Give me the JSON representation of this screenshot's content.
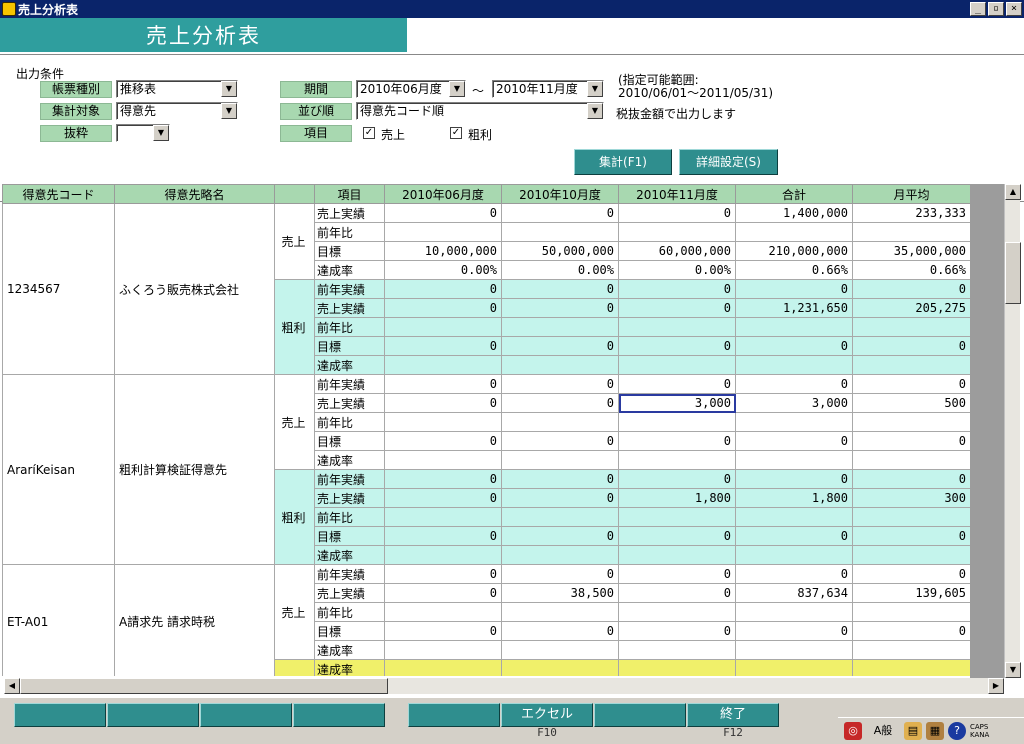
{
  "window": {
    "title": "売上分析表",
    "buttons": [
      "_",
      "▫",
      "×"
    ]
  },
  "header": {
    "title": "売上分析表"
  },
  "conditions": {
    "section_label": "出力条件",
    "report_type": {
      "label": "帳票種別",
      "value": "推移表"
    },
    "aggregate_target": {
      "label": "集計対象",
      "value": "得意先"
    },
    "extract": {
      "label": "抜粋",
      "value": ""
    },
    "period": {
      "label": "期間",
      "from": "2010年06月度",
      "tilde": "～",
      "to": "2010年11月度"
    },
    "sort": {
      "label": "並び順",
      "value": "得意先コード順"
    },
    "items": {
      "label": "項目",
      "sales": "売上",
      "gross": "粗利"
    },
    "range_note_1": "(指定可能範囲:",
    "range_note_2": "2010/06/01～2011/05/31)",
    "tax_note": "税抜金額で出力します",
    "aggregate_button": "集計(F1)",
    "detail_button": "詳細設定(S)"
  },
  "grid": {
    "headers": [
      "得意先コード",
      "得意先略名",
      "",
      "項目",
      "2010年06月度",
      "2010年10月度",
      "2010年11月度",
      "合計",
      "月平均"
    ],
    "customers": [
      {
        "code": "1234567",
        "name": "ふくろう販売株式会社",
        "groups": [
          {
            "label": "売上",
            "teal": false,
            "rows": [
              {
                "item": "売上実績",
                "values": [
                  "0",
                  "0",
                  "0",
                  "1,400,000",
                  "233,333"
                ]
              },
              {
                "item": "前年比",
                "values": [
                  "",
                  "",
                  "",
                  "",
                  ""
                ]
              },
              {
                "item": "目標",
                "values": [
                  "10,000,000",
                  "50,000,000",
                  "60,000,000",
                  "210,000,000",
                  "35,000,000"
                ]
              },
              {
                "item": "達成率",
                "values": [
                  "0.00%",
                  "0.00%",
                  "0.00%",
                  "0.66%",
                  "0.66%"
                ]
              }
            ]
          },
          {
            "label": "粗利",
            "teal": true,
            "rows": [
              {
                "item": "前年実績",
                "values": [
                  "0",
                  "0",
                  "0",
                  "0",
                  "0"
                ]
              },
              {
                "item": "売上実績",
                "values": [
                  "0",
                  "0",
                  "0",
                  "1,231,650",
                  "205,275"
                ]
              },
              {
                "item": "前年比",
                "values": [
                  "",
                  "",
                  "",
                  "",
                  ""
                ]
              },
              {
                "item": "目標",
                "values": [
                  "0",
                  "0",
                  "0",
                  "0",
                  "0"
                ]
              },
              {
                "item": "達成率",
                "values": [
                  "",
                  "",
                  "",
                  "",
                  ""
                ]
              }
            ]
          }
        ]
      },
      {
        "code": "AraríKeisan",
        "name": "粗利計算検証得意先",
        "groups": [
          {
            "label": "売上",
            "teal": false,
            "rows": [
              {
                "item": "前年実績",
                "values": [
                  "0",
                  "0",
                  "0",
                  "0",
                  "0"
                ]
              },
              {
                "item": "売上実績",
                "values": [
                  "0",
                  "0",
                  "3,000",
                  "3,000",
                  "500"
                ],
                "selected": 2
              },
              {
                "item": "前年比",
                "values": [
                  "",
                  "",
                  "",
                  "",
                  ""
                ]
              },
              {
                "item": "目標",
                "values": [
                  "0",
                  "0",
                  "0",
                  "0",
                  "0"
                ]
              },
              {
                "item": "達成率",
                "values": [
                  "",
                  "",
                  "",
                  "",
                  ""
                ]
              }
            ]
          },
          {
            "label": "粗利",
            "teal": true,
            "rows": [
              {
                "item": "前年実績",
                "values": [
                  "0",
                  "0",
                  "0",
                  "0",
                  "0"
                ]
              },
              {
                "item": "売上実績",
                "values": [
                  "0",
                  "0",
                  "1,800",
                  "1,800",
                  "300"
                ]
              },
              {
                "item": "前年比",
                "values": [
                  "",
                  "",
                  "",
                  "",
                  ""
                ]
              },
              {
                "item": "目標",
                "values": [
                  "0",
                  "0",
                  "0",
                  "0",
                  "0"
                ]
              },
              {
                "item": "達成率",
                "values": [
                  "",
                  "",
                  "",
                  "",
                  ""
                ]
              }
            ]
          }
        ]
      },
      {
        "code": "ET-A01",
        "name": "A請求先 請求時税",
        "groups": [
          {
            "label": "売上",
            "teal": false,
            "rows": [
              {
                "item": "前年実績",
                "values": [
                  "0",
                  "0",
                  "0",
                  "0",
                  "0"
                ]
              },
              {
                "item": "売上実績",
                "values": [
                  "0",
                  "38,500",
                  "0",
                  "837,634",
                  "139,605"
                ]
              },
              {
                "item": "前年比",
                "values": [
                  "",
                  "",
                  "",
                  "",
                  ""
                ]
              },
              {
                "item": "目標",
                "values": [
                  "0",
                  "0",
                  "0",
                  "0",
                  "0"
                ]
              },
              {
                "item": "達成率",
                "values": [
                  "",
                  "",
                  "",
                  "",
                  ""
                ]
              }
            ]
          },
          {
            "label": "",
            "teal": true,
            "yellow_first": true,
            "rows": [
              {
                "item": "達成率",
                "values": [
                  "",
                  "",
                  "",
                  "",
                  ""
                ]
              }
            ]
          }
        ]
      }
    ]
  },
  "function_keys": [
    {
      "label": "",
      "sub": ""
    },
    {
      "label": "",
      "sub": ""
    },
    {
      "label": "",
      "sub": ""
    },
    {
      "label": "",
      "sub": ""
    },
    {
      "label": "",
      "sub": ""
    },
    {
      "label": "エクセル",
      "sub": "F10"
    },
    {
      "label": "",
      "sub": ""
    },
    {
      "label": "終了",
      "sub": "F12"
    }
  ],
  "tray": {
    "ime_mode": "A般",
    "caps": "CAPS",
    "kana": "KANA"
  },
  "colors": {
    "title_bar": "#0a246a",
    "header_band": "#2f9e9e",
    "grid_header": "#a8d8b0",
    "teal_row": "#c4f4ec",
    "highlight_row": "#f0f06a"
  }
}
